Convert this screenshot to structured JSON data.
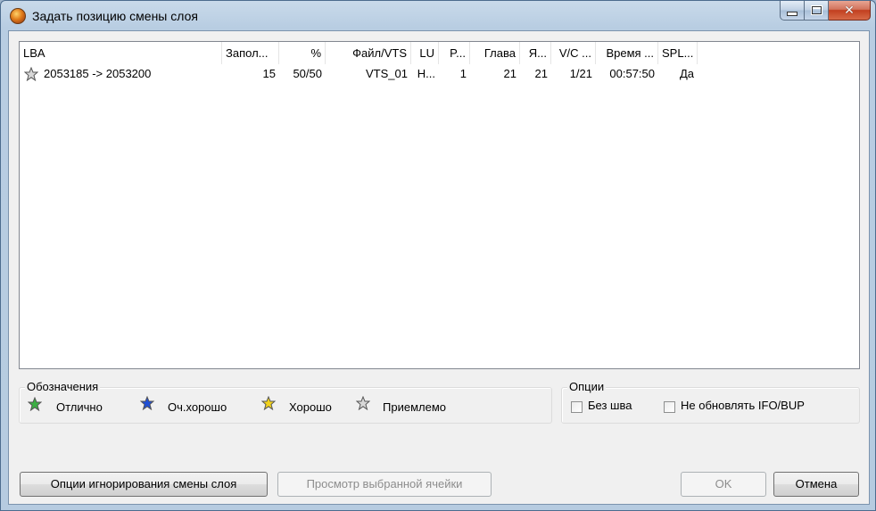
{
  "window": {
    "title": "Задать позицию смены слоя"
  },
  "table": {
    "columns": [
      "LBA",
      "Запол...",
      "%",
      "Файл/VTS",
      "LU",
      "P...",
      "Глава",
      "Я...",
      "V/C ...",
      "Время ...",
      "SPL..."
    ],
    "rows": [
      {
        "rating": "acceptable",
        "cells": [
          "2053185 -> 2053200",
          "15",
          "50/50",
          "VTS_01",
          "Н...",
          "1",
          "21",
          "21",
          "1/21",
          "00:57:50",
          "Да"
        ]
      }
    ]
  },
  "legend": {
    "title": "Обозначения",
    "items": [
      {
        "label": "Отлично",
        "color": "#3cb043"
      },
      {
        "label": "Оч.хорошо",
        "color": "#1f4fd6"
      },
      {
        "label": "Хорошо",
        "color": "#f2d21b"
      },
      {
        "label": "Приемлемо",
        "color": "#d8d8d8"
      }
    ]
  },
  "options": {
    "title": "Опции",
    "seamless": {
      "label": "Без шва",
      "checked": false
    },
    "no_update": {
      "label": "Не обновлять IFO/BUP",
      "checked": false
    }
  },
  "buttons": {
    "ignore_options": "Опции игнорирования смены слоя",
    "view_cell": "Просмотр выбранной ячейки",
    "ok": "OK",
    "cancel": "Отмена"
  }
}
